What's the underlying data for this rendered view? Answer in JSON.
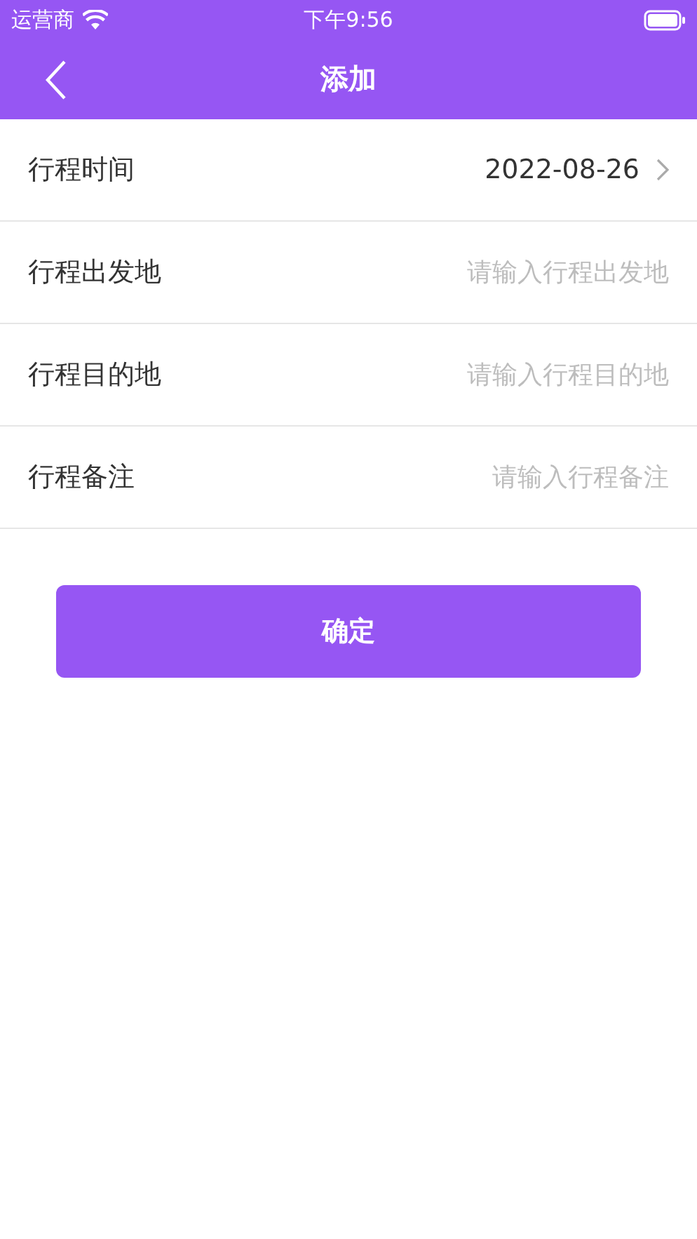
{
  "status_bar": {
    "carrier": "运营商",
    "time": "下午9:56"
  },
  "nav": {
    "title": "添加"
  },
  "fields": [
    {
      "kind": "picker",
      "label": "行程时间",
      "value": "2022-08-26"
    },
    {
      "kind": "input",
      "label": "行程出发地",
      "placeholder": "请输入行程出发地"
    },
    {
      "kind": "input",
      "label": "行程目的地",
      "placeholder": "请输入行程目的地"
    },
    {
      "kind": "input",
      "label": "行程备注",
      "placeholder": "请输入行程备注"
    }
  ],
  "confirm_button": "确定"
}
